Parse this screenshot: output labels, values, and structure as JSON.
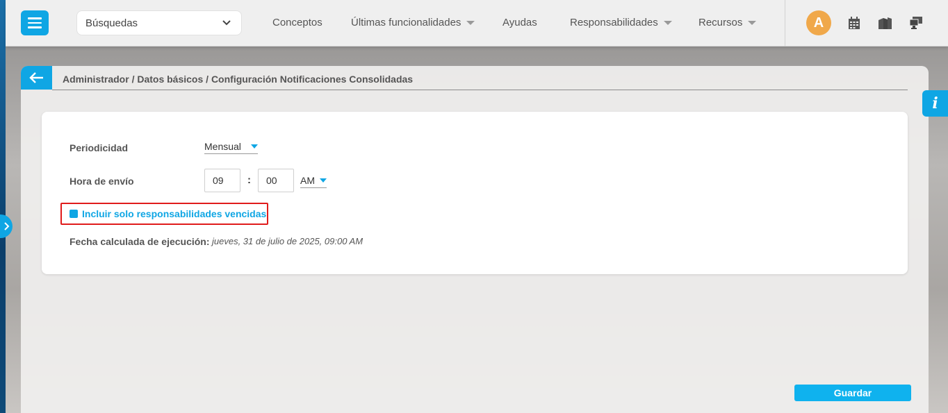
{
  "topbar": {
    "search_select": "Búsquedas",
    "nav": [
      {
        "label": "Conceptos",
        "has_dropdown": false
      },
      {
        "label": "Últimas funcionalidades",
        "has_dropdown": true
      },
      {
        "label": "Ayudas",
        "has_dropdown": false
      },
      {
        "label": "Responsabilidades",
        "has_dropdown": true
      },
      {
        "label": "Recursos",
        "has_dropdown": true
      }
    ],
    "avatar_letter": "A",
    "icons": [
      "calendar-icon",
      "documents-icon",
      "monitor-icon"
    ]
  },
  "breadcrumb": "Administrador / Datos básicos / Configuración Notificaciones Consolidadas",
  "info_label": "i",
  "form": {
    "periodicity_label": "Periodicidad",
    "periodicity_value": "Mensual",
    "send_time_label": "Hora de envío",
    "hour": "09",
    "time_separator": ":",
    "minute": "00",
    "ampm": "AM",
    "checkbox_label": "Incluir solo responsabilidades vencidas",
    "calc_date_label": "Fecha calculada de ejecución:",
    "calc_date_value": "jueves, 31 de julio de 2025, 09:00 AM"
  },
  "save_label": "Guardar",
  "colors": {
    "accent": "#0fa6e4",
    "highlight": "#e01b1b",
    "avatar": "#f0a84a"
  }
}
